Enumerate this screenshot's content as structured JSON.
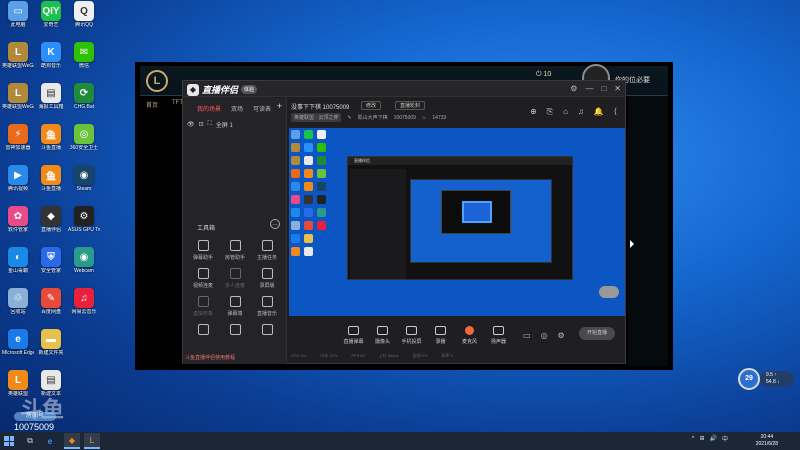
{
  "desktop": {
    "icons": [
      {
        "label": "此电脑",
        "color": "#5aa0e8",
        "glyph": "▭"
      },
      {
        "label": "爱奇艺",
        "color": "#19c24a",
        "glyph": "QIY"
      },
      {
        "label": "腾讯QQ",
        "color": "#f0f0f0",
        "glyph": "Q"
      },
      {
        "label": "英雄联盟WeGame版",
        "color": "#b08a3a",
        "glyph": "L"
      },
      {
        "label": "酷狗音乐",
        "color": "#2c8ef8",
        "glyph": "K"
      },
      {
        "label": "微信",
        "color": "#2dc100",
        "glyph": "✉"
      },
      {
        "label": "英雄联盟WeGame版",
        "color": "#b08a3a",
        "glyph": "L"
      },
      {
        "label": "海报工具箱",
        "color": "#e8e8e8",
        "glyph": "▤"
      },
      {
        "label": "CHG.Bat",
        "color": "#1f8a3a",
        "glyph": "⟳"
      },
      {
        "label": "雷神加速器",
        "color": "#e86a1a",
        "glyph": "⚡"
      },
      {
        "label": "斗鱼直播",
        "color": "#f08a1a",
        "glyph": "鱼"
      },
      {
        "label": "360安全卫士",
        "color": "#6ac33a",
        "glyph": "◎"
      },
      {
        "label": "腾讯视频",
        "color": "#2a8ae8",
        "glyph": "▶"
      },
      {
        "label": "斗鱼直播",
        "color": "#f08a1a",
        "glyph": "鱼"
      },
      {
        "label": "Steam",
        "color": "#17456a",
        "glyph": "◉"
      },
      {
        "label": "软件管家",
        "color": "#e84a8a",
        "glyph": "✿"
      },
      {
        "label": "直播伴侣",
        "color": "#333",
        "glyph": "◆"
      },
      {
        "label": "ASUS GPU Tweak",
        "color": "#222",
        "glyph": "⚙"
      },
      {
        "label": "金山毒霸",
        "color": "#1a8ae8",
        "glyph": "◐"
      },
      {
        "label": "安全管家",
        "color": "#2a6ae8",
        "glyph": "⛨"
      },
      {
        "label": "Webcam",
        "color": "#2a9a8a",
        "glyph": "◉"
      },
      {
        "label": "回收站",
        "color": "#8ab0d8",
        "glyph": "♲"
      },
      {
        "label": "百度网盘",
        "color": "#e84a3a",
        "glyph": "✎"
      },
      {
        "label": "网易云音乐",
        "color": "#e8203a",
        "glyph": "♫"
      },
      {
        "label": "Microsoft Edge",
        "color": "#1a7ae8",
        "glyph": "e"
      },
      {
        "label": "新建文件夹",
        "color": "#e8c04a",
        "glyph": "▬"
      },
      {
        "label": "",
        "color": "",
        "glyph": ""
      },
      {
        "label": "英雄联盟",
        "color": "#f08a1a",
        "glyph": "L"
      },
      {
        "label": "新建文本",
        "color": "#e8e8e8",
        "glyph": "▤"
      }
    ],
    "watermark": {
      "logo": "斗鱼",
      "room_label": "房间号",
      "room_id": "10075009"
    }
  },
  "lol_client": {
    "logo": "L",
    "nav": [
      "首页",
      "TFT"
    ],
    "currency": "10",
    "right_text": "你的位必要"
  },
  "app": {
    "brand": "直播伴侣",
    "brand_badge": "体验",
    "title_controls": [
      "⚙",
      "—",
      "□",
      "✕"
    ],
    "left_tabs": {
      "active": "我的场景",
      "tabs": [
        "我的场景",
        "双场",
        "可读表"
      ]
    },
    "add_label": "+",
    "scene_name": "全屏 1",
    "toolbox_title": "工具箱",
    "toolbox_more": "…",
    "tools": [
      {
        "label": "弹幕助手",
        "dim": false
      },
      {
        "label": "房管助手",
        "dim": false
      },
      {
        "label": "主播任务",
        "dim": false
      },
      {
        "label": "视频连麦",
        "dim": false
      },
      {
        "label": "多人连麦",
        "dim": true
      },
      {
        "label": "录屏版",
        "dim": false
      },
      {
        "label": "虚拟形象",
        "dim": true
      },
      {
        "label": "弹幕墙",
        "dim": false
      },
      {
        "label": "直播音乐",
        "dim": false
      },
      {
        "label": "",
        "dim": false
      },
      {
        "label": "",
        "dim": false
      },
      {
        "label": "",
        "dim": false
      }
    ],
    "notice": "斗鱼直播伴侣使用教程",
    "room_title": "没事下下棋 10075009",
    "edit_chip": "修改",
    "share_chip": "直播轮封",
    "category_tag": "英雄联盟 · 云顶之弈",
    "location": "凯山大声下棋",
    "room_number": "10075009",
    "viewers": "14733",
    "app_icons": [
      "⊕",
      "⎘",
      "⌂",
      "♫",
      "🔔",
      "⟨"
    ],
    "bottom_buttons": [
      {
        "label": "直播弹幕",
        "red": false
      },
      {
        "label": "摄像头",
        "red": false
      },
      {
        "label": "手机投屏",
        "red": false
      },
      {
        "label": "录播",
        "red": false
      },
      {
        "label": "麦克风",
        "red": true
      },
      {
        "label": "扬声器",
        "red": false
      }
    ],
    "go_live": "开始直播",
    "status": [
      "CPU 0%",
      "内存 32%",
      "FPS 60",
      "上行 0kbps",
      "丢帧 0%",
      "码率 0"
    ]
  },
  "perf_widget": {
    "percent": "29",
    "line1": "9.5 ↑",
    "line2": "54.8 ↓"
  },
  "taskbar": {
    "tray": [
      "^",
      "⊞",
      "🔊",
      "中"
    ],
    "time": "20:44",
    "date": "2021/6/28"
  }
}
